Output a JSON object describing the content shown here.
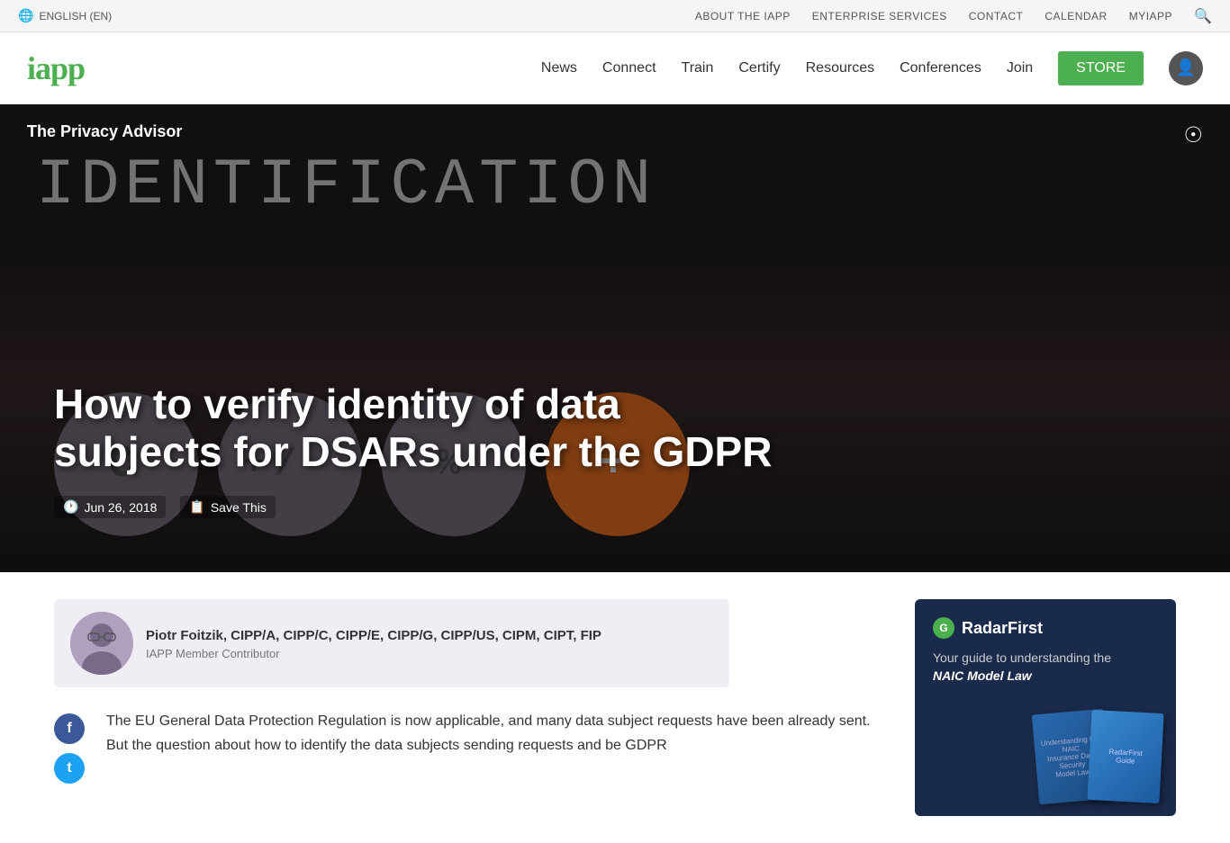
{
  "topbar": {
    "language": "ENGLISH (EN)",
    "links": [
      "ABOUT THE IAPP",
      "ENTERPRISE SERVICES",
      "CONTACT",
      "CALENDAR",
      "MYIAPP"
    ],
    "search_icon": "search"
  },
  "mainnav": {
    "logo": "iapp",
    "links": [
      "News",
      "Connect",
      "Train",
      "Certify",
      "Resources",
      "Conferences",
      "Join"
    ],
    "store_label": "STORE"
  },
  "hero": {
    "section": "The Privacy Advisor",
    "title": "How to verify identity of data subjects for DSARs under the GDPR",
    "date": "Jun 26, 2018",
    "save_label": "Save This",
    "calc_display": "IDENTIFICATION"
  },
  "author": {
    "name": "Piotr Foitzik, CIPP/A, CIPP/C, CIPP/E, CIPP/G, CIPP/US, CIPM, CIPT, FIP",
    "role": "IAPP Member Contributor"
  },
  "article": {
    "intro": "The EU General Data Protection Regulation is now applicable, and many data subject requests have been already sent. But the question about how to identify the data subjects sending requests and be GDPR"
  },
  "sidebar": {
    "ad": {
      "logo": "RadarFirst",
      "tagline": "Your guide to understanding the",
      "title": "NAIC Model Law"
    }
  }
}
